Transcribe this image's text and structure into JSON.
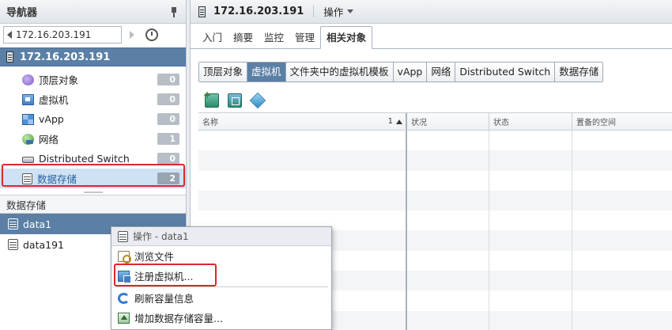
{
  "navigator": {
    "title": "导航器",
    "history_value": "172.16.203.191",
    "host_name": "172.16.203.191",
    "items": [
      {
        "label": "顶层对象",
        "count": "0",
        "icon": "top-level-objects-icon"
      },
      {
        "label": "虚拟机",
        "count": "0",
        "icon": "vm-icon"
      },
      {
        "label": "vApp",
        "count": "0",
        "icon": "vapp-icon"
      },
      {
        "label": "网络",
        "count": "1",
        "icon": "network-icon"
      },
      {
        "label": "Distributed Switch",
        "count": "0",
        "icon": "switch-icon"
      },
      {
        "label": "数据存储",
        "count": "2",
        "icon": "datastore-icon"
      }
    ],
    "datastore_panel": {
      "title": "数据存储",
      "rows": [
        "data1",
        "data191"
      ]
    }
  },
  "main": {
    "host_title": "172.16.203.191",
    "actions_label": "操作",
    "tabs": [
      "入门",
      "摘要",
      "监控",
      "管理",
      "相关对象"
    ],
    "subtabs": [
      "顶层对象",
      "虚拟机",
      "文件夹中的虚拟机模板",
      "vApp",
      "网络",
      "Distributed Switch",
      "数据存储"
    ],
    "grid": {
      "columns": [
        "名称",
        "状况",
        "状态",
        "置备的空间"
      ],
      "sort_indicator": "1"
    }
  },
  "context_menu": {
    "header": "操作 - data1",
    "items": [
      "浏览文件",
      "注册虚拟机...",
      "刷新容量信息",
      "增加数据存储容量..."
    ]
  },
  "colors": {
    "selection_blue": "#5b7fa5",
    "highlight_red": "#e0262a"
  }
}
